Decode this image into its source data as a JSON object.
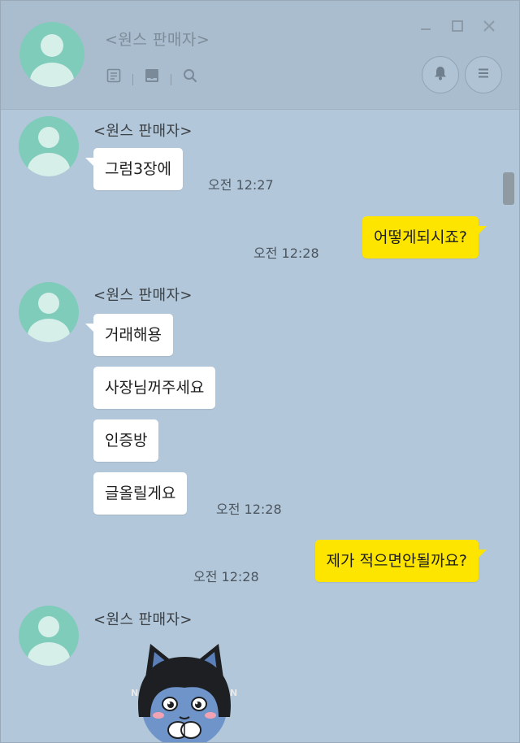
{
  "header": {
    "title": "<원스 판매자>",
    "tools": [
      "memo-icon",
      "album-icon",
      "search-icon"
    ],
    "window_controls": [
      "minimize",
      "maximize",
      "close"
    ],
    "actions": [
      "bell-icon",
      "menu-icon"
    ]
  },
  "messages": [
    {
      "sender": "<원스 판매자>",
      "bubbles": [
        "그럼3장에"
      ],
      "time": "오전 12:27"
    },
    {
      "mine": true,
      "bubbles": [
        "어떻게되시죠?"
      ],
      "time": "오전 12:28"
    },
    {
      "sender": "<원스 판매자>",
      "bubbles": [
        "거래해용",
        "사장님꺼주세요",
        "인증방",
        "글올릴게요"
      ],
      "time": "오전 12:28"
    },
    {
      "mine": true,
      "bubbles": [
        "제가 적으면안될까요?"
      ],
      "time": "오전 12:28"
    },
    {
      "sender": "<원스 판매자>",
      "sticker": "cat-character-sticker"
    }
  ],
  "colors": {
    "chat_bg": "#b2c7d9",
    "my_bubble": "#fee500",
    "their_bubble": "#ffffff",
    "avatar": "#7fccbb"
  }
}
